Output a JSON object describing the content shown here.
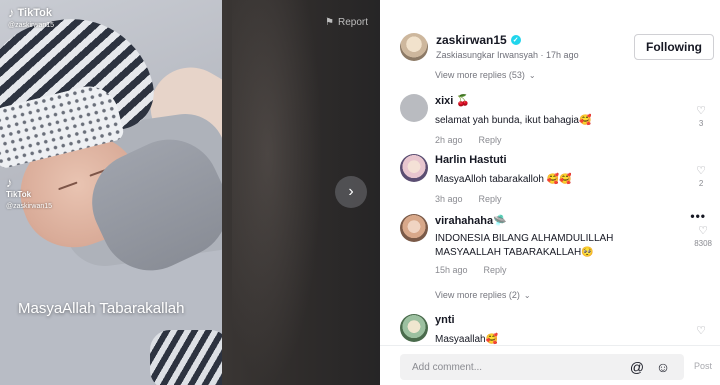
{
  "video": {
    "brand": "TikTok",
    "handle": "@zaskirwan15",
    "caption": "MasyaAllah Tabarakallah",
    "report_label": "Report"
  },
  "author": {
    "username": "zaskirwan15",
    "subtitle": "Zaskiasungkar Irwansyah · 17h ago",
    "follow_label": "Following"
  },
  "view_more_top": "View more replies (53)",
  "comments": [
    {
      "name": "xixi 🍒",
      "text": "selamat yah bunda, ikut bahagia🥰",
      "time": "2h ago",
      "reply": "Reply",
      "likes": "3"
    },
    {
      "name": "Harlin Hastuti",
      "text": "MasyaAlloh tabarakalloh 🥰🥰",
      "time": "3h ago",
      "reply": "Reply",
      "likes": "2"
    },
    {
      "name": "virahahaha🛸",
      "text": "INDONESIA BILANG ALHAMDULILLAH MASYAALLAH TABARAKALLAH🥺",
      "time": "15h ago",
      "reply": "Reply",
      "likes": "8308"
    },
    {
      "name": "ynti",
      "text": "Masyaallah🥰",
      "likes": ""
    }
  ],
  "view_more_mid": "View more replies (2)",
  "compose": {
    "placeholder": "Add comment...",
    "post_label": "Post"
  },
  "icons": {
    "next": "chevron-right-icon",
    "report": "flag-icon",
    "like": "heart-outline-icon",
    "mention": "at-icon",
    "emoji": "emoji-icon"
  },
  "colors": {
    "verified": "#20d5ec",
    "text": "#161823",
    "muted": "#8a8b91"
  }
}
